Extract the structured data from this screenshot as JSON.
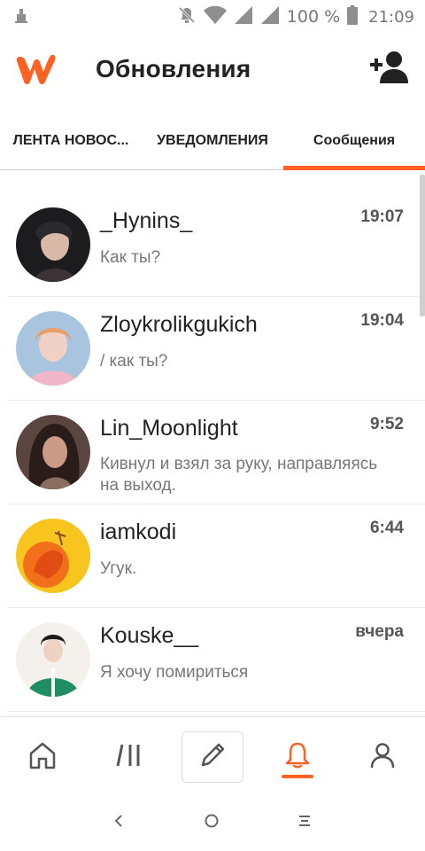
{
  "status_bar": {
    "battery": "100 %",
    "time": "21:09"
  },
  "app_bar": {
    "title": "Обновления"
  },
  "tabs": [
    {
      "label": "ЛЕНТА НОВОС...",
      "active": false
    },
    {
      "label": "УВЕДОМЛЕНИЯ",
      "active": false
    },
    {
      "label": "Сообщения",
      "active": true
    }
  ],
  "messages": [
    {
      "name": "_Hynins_",
      "time": "19:07",
      "preview": "Как ты?"
    },
    {
      "name": "Zloykrolikgukich",
      "time": "19:04",
      "preview": "/ как ты?"
    },
    {
      "name": "Lin_Moonlight",
      "time": "9:52",
      "preview": "Кивнул и взял за руку, направляясь на выход."
    },
    {
      "name": "iamkodi",
      "time": "6:44",
      "preview": "Угук."
    },
    {
      "name": "Kouske__",
      "time": "вчера",
      "preview": "Я хочу помириться"
    }
  ],
  "colors": {
    "accent": "#ff6122"
  },
  "bottom_nav": [
    "home-icon",
    "library-icon",
    "write-icon",
    "notifications-icon",
    "profile-icon"
  ]
}
